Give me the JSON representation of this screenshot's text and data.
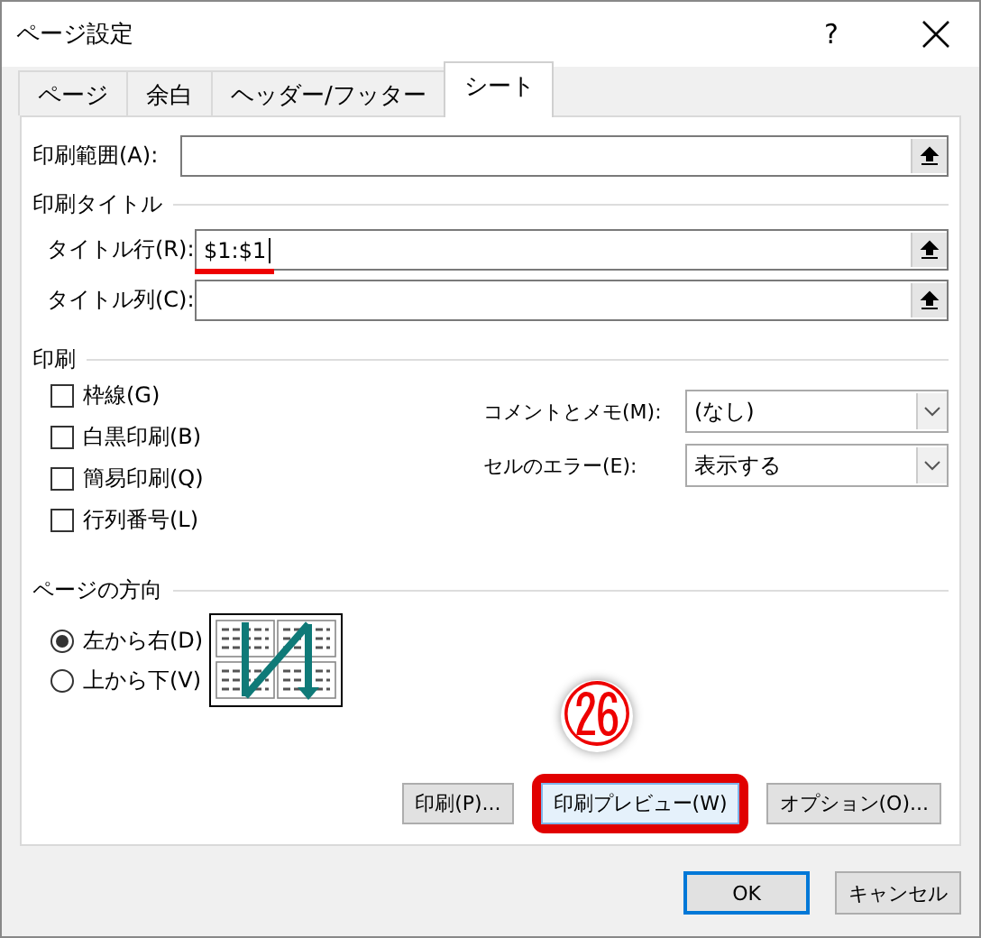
{
  "window": {
    "title": "ページ設定",
    "help": "?"
  },
  "tabs": [
    {
      "label": "ページ",
      "selected": false
    },
    {
      "label": "余白",
      "selected": false
    },
    {
      "label": "ヘッダー/フッター",
      "selected": false
    },
    {
      "label": "シート",
      "selected": true
    }
  ],
  "print_area": {
    "label": "印刷範囲(A):"
  },
  "print_titles": {
    "heading": "印刷タイトル",
    "fields": [
      {
        "label": "タイトル行(R):",
        "value": "$1:$1",
        "marked": true
      },
      {
        "label": "タイトル列(C):",
        "marked": false
      }
    ]
  },
  "print": {
    "heading": "印刷",
    "checkboxes": [
      {
        "label": "枠線(G)",
        "checked": false
      },
      {
        "label": "白黒印刷(B)",
        "checked": false
      },
      {
        "label": "簡易印刷(Q)",
        "checked": false
      },
      {
        "label": "行列番号(L)",
        "checked": false
      }
    ],
    "dropdowns": [
      {
        "label": "コメントとメモ(M):",
        "value": "(なし)"
      },
      {
        "label": "セルのエラー(E):",
        "value": "表示する"
      }
    ]
  },
  "page_order": {
    "heading": "ページの方向",
    "options": [
      {
        "label": "左から右(D)",
        "selected": true
      },
      {
        "label": "上から下(V)",
        "selected": false
      }
    ]
  },
  "step_badge": "㉖",
  "panel_buttons": [
    {
      "label": "印刷(P)...",
      "highlighted": false
    },
    {
      "label": "印刷プレビュー(W)",
      "highlighted": true
    },
    {
      "label": "オプション(O)...",
      "highlighted": false
    }
  ],
  "buttons": [
    {
      "label": "OK",
      "default": true
    },
    {
      "label": "キャンセル",
      "default": false
    }
  ]
}
